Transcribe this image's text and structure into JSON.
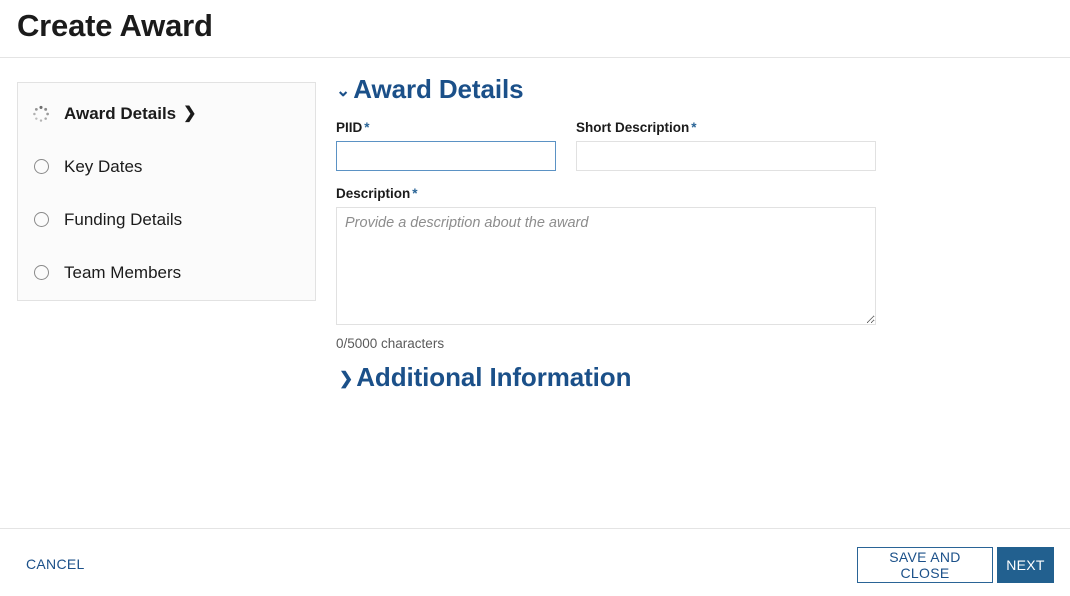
{
  "header": {
    "title": "Create Award"
  },
  "sidebar": {
    "items": [
      {
        "label": "Award Details",
        "icon": "dotted-spinner-circle-icon",
        "chevron": "❯",
        "active": true
      },
      {
        "label": "Key Dates",
        "icon": "empty-circle-icon",
        "active": false
      },
      {
        "label": "Funding Details",
        "icon": "empty-circle-icon",
        "active": false
      },
      {
        "label": "Team Members",
        "icon": "empty-circle-icon",
        "active": false
      }
    ]
  },
  "main": {
    "award_details": {
      "title": "Award Details",
      "caret": "⌄",
      "caret_state": "expanded",
      "piid": {
        "label": "PIID",
        "required_marker": "*",
        "value": "",
        "placeholder": "",
        "focused": true
      },
      "short_description": {
        "label": "Short Description",
        "required_marker": "*",
        "value": "",
        "placeholder": "",
        "focused": false
      },
      "description": {
        "label": "Description",
        "required_marker": "*",
        "value": "",
        "placeholder": "Provide a description about the award",
        "char_count": "0/5000 characters"
      }
    },
    "additional_information": {
      "title": "Additional Information",
      "caret": "❯",
      "caret_state": "collapsed"
    }
  },
  "footer": {
    "cancel_label": "CANCEL",
    "save_and_close_label": "SAVE AND CLOSE",
    "next_label": "NEXT"
  },
  "colors": {
    "accent_blue": "#1b5089",
    "primary_button_bg": "#22608f",
    "focus_border": "#5b92c4",
    "field_border": "#e1e1e1",
    "divider": "#e4e4e4",
    "sidebar_bg": "#fbfbfb",
    "text": "#1b1b1b",
    "muted_text": "#5b5b5b"
  }
}
